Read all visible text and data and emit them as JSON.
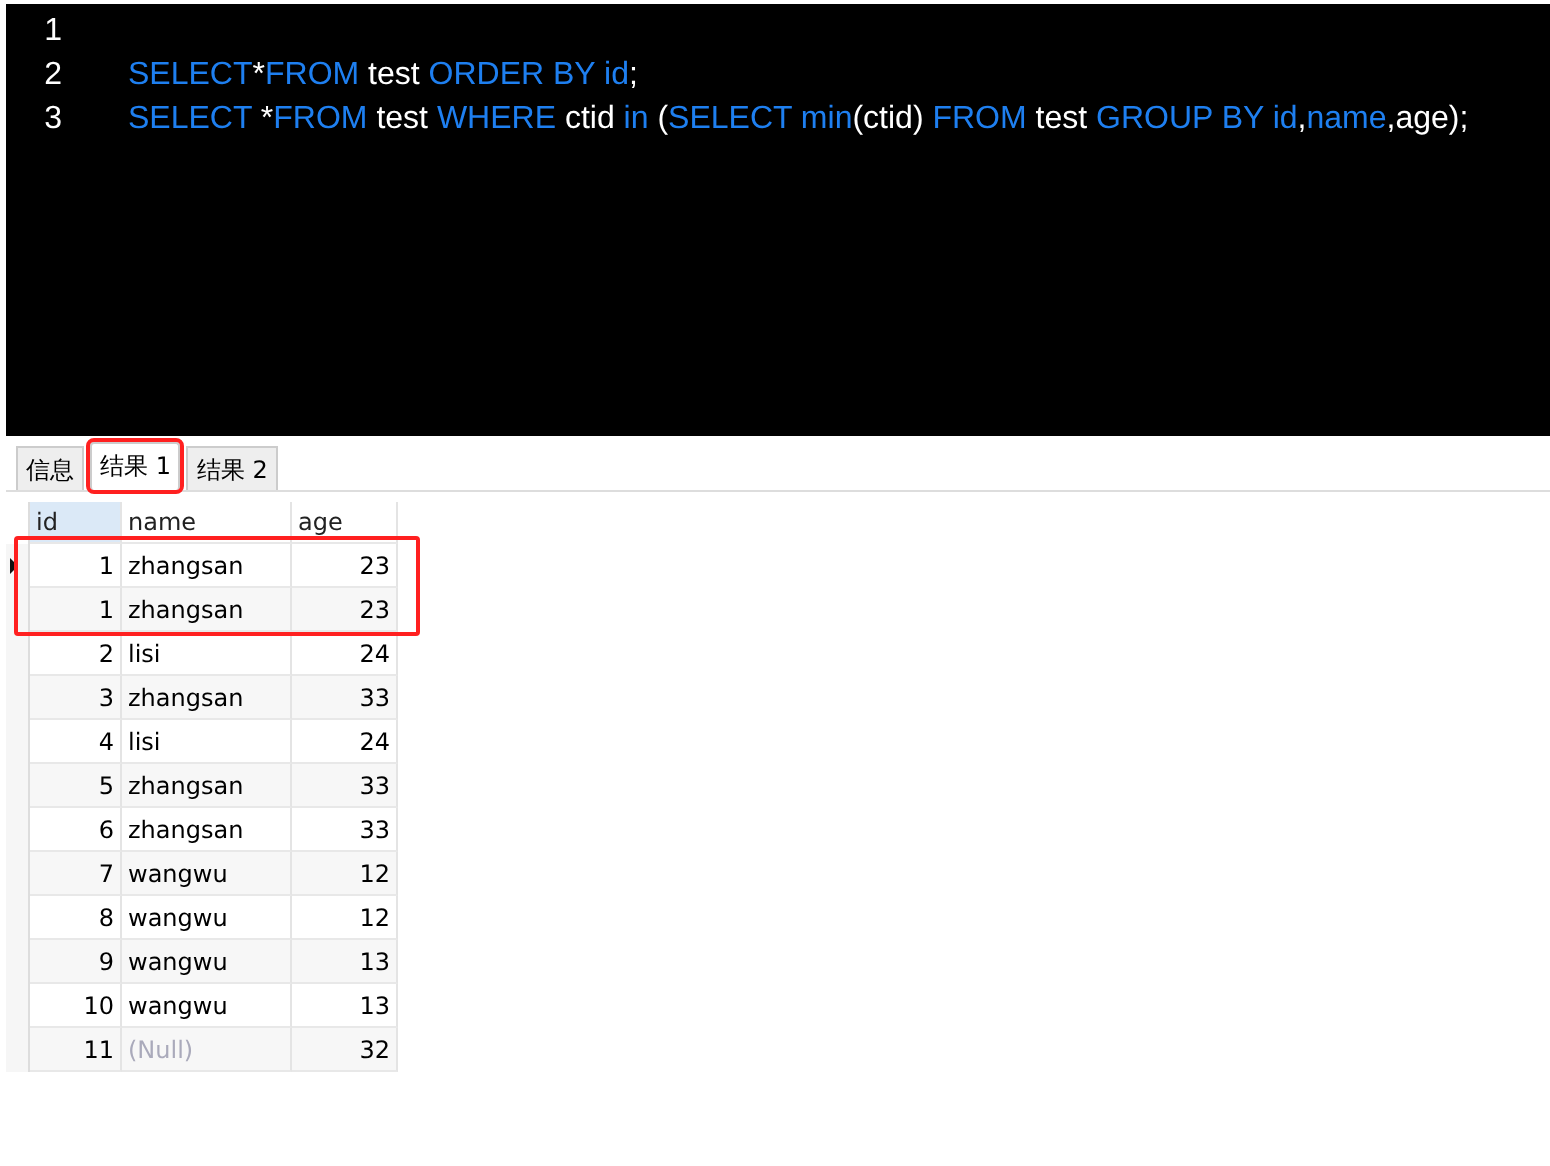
{
  "editor": {
    "lines": [
      {
        "number": "1"
      },
      {
        "number": "2",
        "tokens": [
          {
            "kind": "keyword",
            "text": "SELECT"
          },
          {
            "kind": "plain",
            "text": "*"
          },
          {
            "kind": "keyword",
            "text": "FROM"
          },
          {
            "kind": "plain",
            "text": " test "
          },
          {
            "kind": "keyword",
            "text": "ORDER BY id"
          },
          {
            "kind": "plain",
            "text": ";"
          }
        ]
      },
      {
        "number": "3",
        "tokens": [
          {
            "kind": "keyword",
            "text": "SELECT "
          },
          {
            "kind": "plain",
            "text": "*"
          },
          {
            "kind": "keyword",
            "text": "FROM"
          },
          {
            "kind": "plain",
            "text": " test "
          },
          {
            "kind": "keyword",
            "text": "WHERE"
          },
          {
            "kind": "plain",
            "text": " ctid "
          },
          {
            "kind": "keyword",
            "text": "in"
          },
          {
            "kind": "plain",
            "text": " ("
          },
          {
            "kind": "keyword",
            "text": "SELECT min"
          },
          {
            "kind": "plain",
            "text": "(ctid) "
          },
          {
            "kind": "keyword",
            "text": "FROM"
          },
          {
            "kind": "plain",
            "text": " test "
          },
          {
            "kind": "keyword",
            "text": "GROUP BY id"
          },
          {
            "kind": "plain",
            "text": ","
          },
          {
            "kind": "keyword",
            "text": "name"
          },
          {
            "kind": "plain",
            "text": ",age);"
          }
        ]
      }
    ]
  },
  "tabs": [
    {
      "label": "信息",
      "selected": false,
      "highlighted": false
    },
    {
      "label": "结果 1",
      "selected": true,
      "highlighted": true
    },
    {
      "label": "结果 2",
      "selected": false,
      "highlighted": false
    }
  ],
  "table": {
    "columns": [
      "id",
      "name",
      "age"
    ],
    "rows": [
      {
        "cells": [
          {
            "text": "1",
            "null": false
          },
          {
            "text": "zhangsan",
            "null": false
          },
          {
            "text": "23",
            "null": false
          }
        ],
        "current": true,
        "highlighted": true
      },
      {
        "cells": [
          {
            "text": "1",
            "null": false
          },
          {
            "text": "zhangsan",
            "null": false
          },
          {
            "text": "23",
            "null": false
          }
        ],
        "current": false,
        "highlighted": true
      },
      {
        "cells": [
          {
            "text": "2",
            "null": false
          },
          {
            "text": "lisi",
            "null": false
          },
          {
            "text": "24",
            "null": false
          }
        ],
        "current": false,
        "highlighted": false
      },
      {
        "cells": [
          {
            "text": "3",
            "null": false
          },
          {
            "text": "zhangsan",
            "null": false
          },
          {
            "text": "33",
            "null": false
          }
        ],
        "current": false,
        "highlighted": false
      },
      {
        "cells": [
          {
            "text": "4",
            "null": false
          },
          {
            "text": "lisi",
            "null": false
          },
          {
            "text": "24",
            "null": false
          }
        ],
        "current": false,
        "highlighted": false
      },
      {
        "cells": [
          {
            "text": "5",
            "null": false
          },
          {
            "text": "zhangsan",
            "null": false
          },
          {
            "text": "33",
            "null": false
          }
        ],
        "current": false,
        "highlighted": false
      },
      {
        "cells": [
          {
            "text": "6",
            "null": false
          },
          {
            "text": "zhangsan",
            "null": false
          },
          {
            "text": "33",
            "null": false
          }
        ],
        "current": false,
        "highlighted": false
      },
      {
        "cells": [
          {
            "text": "7",
            "null": false
          },
          {
            "text": "wangwu",
            "null": false
          },
          {
            "text": "12",
            "null": false
          }
        ],
        "current": false,
        "highlighted": false
      },
      {
        "cells": [
          {
            "text": "8",
            "null": false
          },
          {
            "text": "wangwu",
            "null": false
          },
          {
            "text": "12",
            "null": false
          }
        ],
        "current": false,
        "highlighted": false
      },
      {
        "cells": [
          {
            "text": "9",
            "null": false
          },
          {
            "text": "wangwu",
            "null": false
          },
          {
            "text": "13",
            "null": false
          }
        ],
        "current": false,
        "highlighted": false
      },
      {
        "cells": [
          {
            "text": "10",
            "null": false
          },
          {
            "text": "wangwu",
            "null": false
          },
          {
            "text": "13",
            "null": false
          }
        ],
        "current": false,
        "highlighted": false
      },
      {
        "cells": [
          {
            "text": "11",
            "null": false
          },
          {
            "text": "(Null)",
            "null": true
          },
          {
            "text": "32",
            "null": false
          }
        ],
        "current": false,
        "highlighted": false
      }
    ]
  }
}
